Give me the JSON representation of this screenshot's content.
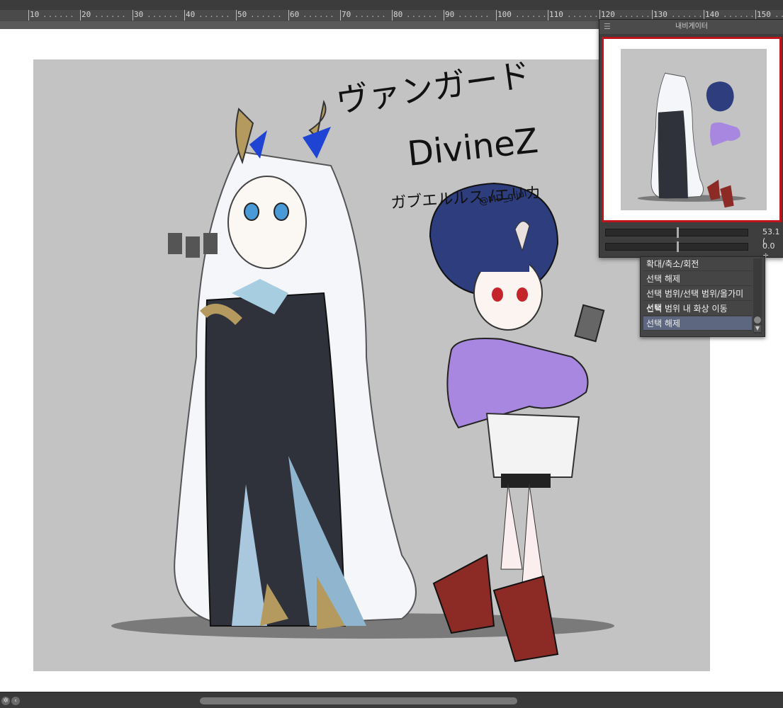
{
  "ruler": {
    "labels": [
      "10",
      "20",
      "30",
      "40",
      "50",
      "60",
      "70",
      "80",
      "90",
      "100",
      "110",
      "120",
      "130",
      "140",
      "150"
    ]
  },
  "artwork": {
    "title_line1": "ヴァンガード",
    "title_line2": "DivineZ",
    "subtitle": "ガブエルルス /エリカ",
    "handle": "@MD_gijul"
  },
  "navigator": {
    "title": "내비게이터",
    "zoom_value": "53.1 (",
    "rotate_value": "0.0 ÷"
  },
  "context_menu": {
    "items": [
      {
        "label": "확대/축소/회전"
      },
      {
        "label": "선택 해제"
      },
      {
        "label": "선택 범위/선택 범위/올가미 선택"
      },
      {
        "label": "선택 범위 내 화상 이동"
      },
      {
        "label": "선택 해제"
      }
    ],
    "selected_index": 4
  },
  "icons": {
    "panel_menu": "menu-icon",
    "scroll_left": "chevron-left-icon",
    "scroll_down": "chevron-down-icon",
    "gear": "gear-icon"
  },
  "colors": {
    "canvas_gray": "#c3c3c3",
    "navigator_frame": "#c0141b",
    "selected_item": "#5d6780"
  }
}
